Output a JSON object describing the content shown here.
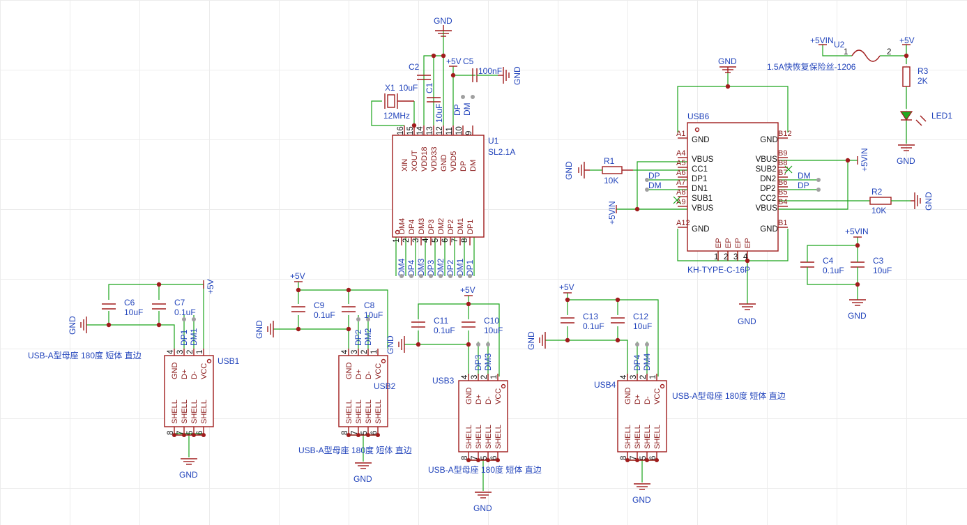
{
  "labels": {
    "gnd": "GND",
    "v5": "+5V",
    "v5in": "+5VIN",
    "dp": "DP",
    "dm": "DM",
    "dp1": "DP1",
    "dm1": "DM1",
    "dp2": "DP2",
    "dm2": "DM2",
    "dp3": "DP3",
    "dm3": "DM3",
    "dp4": "DP4",
    "dm4": "DM4"
  },
  "components": {
    "u1": {
      "ref": "U1",
      "value": "SL2.1A"
    },
    "x1": {
      "ref": "X1",
      "value": "12MHz"
    },
    "c1": {
      "ref": "C1",
      "value": "10uF"
    },
    "c2": {
      "ref": "C2",
      "value": "10uF"
    },
    "c5": {
      "ref": "C5",
      "value": "100nF"
    },
    "usb6": {
      "ref": "USB6",
      "value": "KH-TYPE-C-16P"
    },
    "r1": {
      "ref": "R1",
      "value": "10K"
    },
    "r2": {
      "ref": "R2",
      "value": "10K"
    },
    "r3": {
      "ref": "R3",
      "value": "2K"
    },
    "u2": {
      "ref": "U2",
      "value": "1.5A快恢复保险丝-1206"
    },
    "led1": {
      "ref": "LED1"
    },
    "c3": {
      "ref": "C3",
      "value": "10uF"
    },
    "c4": {
      "ref": "C4",
      "value": "0.1uF"
    },
    "c6": {
      "ref": "C6",
      "value": "10uF"
    },
    "c7": {
      "ref": "C7",
      "value": "0.1uF"
    },
    "c8": {
      "ref": "C8",
      "value": "10uF"
    },
    "c9": {
      "ref": "C9",
      "value": "0.1uF"
    },
    "c10": {
      "ref": "C10",
      "value": "10uF"
    },
    "c11": {
      "ref": "C11",
      "value": "0.1uF"
    },
    "c12": {
      "ref": "C12",
      "value": "10uF"
    },
    "c13": {
      "ref": "C13",
      "value": "0.1uF"
    },
    "usb1": {
      "ref": "USB1"
    },
    "usb2": {
      "ref": "USB2"
    },
    "usb3": {
      "ref": "USB3"
    },
    "usb4": {
      "ref": "USB4"
    },
    "usb_a_value": "USB-A型母座 180度 短体 直边"
  },
  "pins": {
    "u1_top": [
      "XIN",
      "XOUT",
      "VDD18",
      "VDD33",
      "GND",
      "VDD5",
      "DP",
      "DM"
    ],
    "u1_top_nums": [
      "16",
      "15",
      "14",
      "13",
      "12",
      "11",
      "10",
      "9"
    ],
    "u1_bottom": [
      "DM4",
      "DP4",
      "DM3",
      "DP3",
      "DM2",
      "DP2",
      "DM1",
      "DP1"
    ],
    "u1_bottom_nums": [
      "1",
      "2",
      "3",
      "4",
      "5",
      "6",
      "7",
      "8"
    ],
    "usb6_left": [
      "GND",
      "VBUS",
      "CC1",
      "DP1",
      "DN1",
      "SUB1",
      "VBUS",
      "GND"
    ],
    "usb6_left_nums": [
      "A1",
      "A4",
      "A5",
      "A6",
      "A7",
      "A8",
      "A9",
      "A12"
    ],
    "usb6_right": [
      "GND",
      "VBUS",
      "SUB2",
      "DN2",
      "DP2",
      "CC2",
      "VBUS",
      "GND"
    ],
    "usb6_right_nums": [
      "B12",
      "B9",
      "B8",
      "B7",
      "B6",
      "B5",
      "B4",
      "B1"
    ],
    "usb6_ep": [
      "EP",
      "EP",
      "EP",
      "EP"
    ],
    "usb6_ep_nums": [
      "1",
      "2",
      "3",
      "4"
    ],
    "usba_top": [
      "GND",
      "D+",
      "D-",
      "VCC"
    ],
    "usba_top_nums": [
      "4",
      "3",
      "2",
      "1"
    ],
    "usba_shell": [
      "SHELL",
      "SHELL",
      "SHELL",
      "SHELL"
    ],
    "usba_shell_nums": [
      "8",
      "7",
      "5",
      "6"
    ],
    "fuse_nums": [
      "1",
      "2"
    ]
  }
}
